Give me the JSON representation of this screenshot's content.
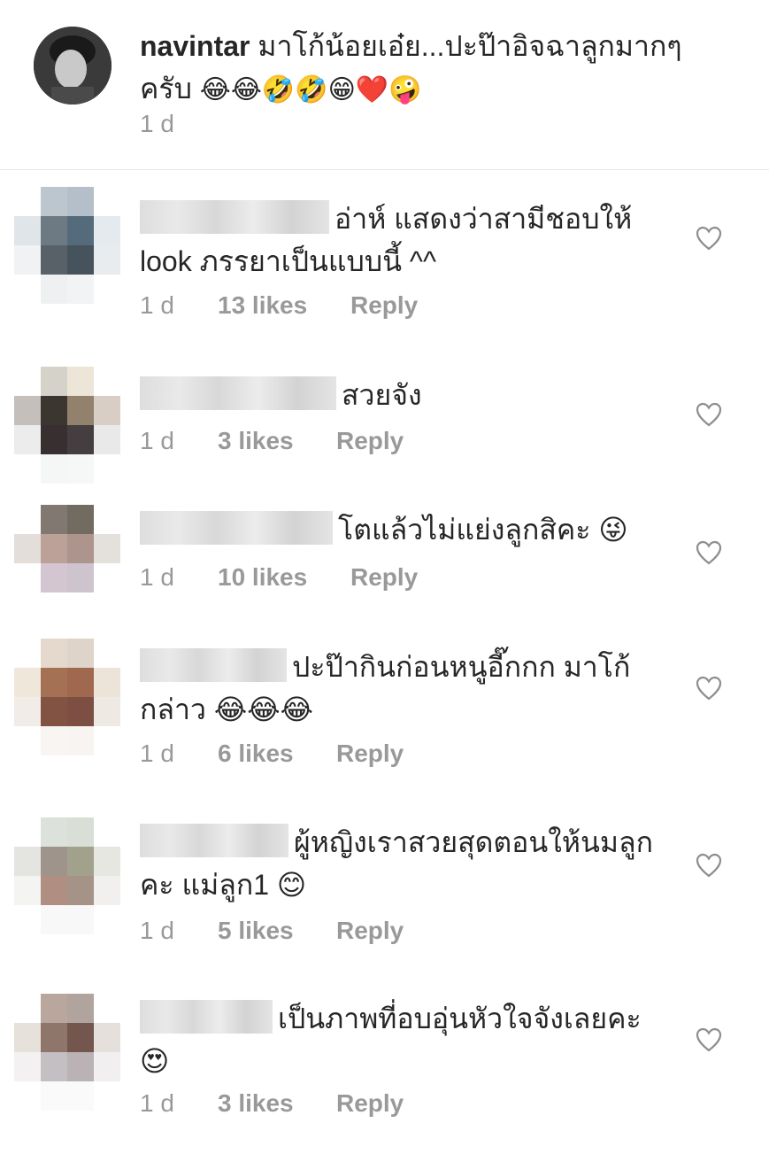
{
  "caption": {
    "username": "navintar",
    "text": "มาโก้น้อยเอ๋ย...ปะป๊าอิจฉาลูกมากๆ ครับ",
    "emojis": [
      "😂",
      "😂",
      "🤣",
      "🤣",
      "😁",
      "❤️",
      "🤪"
    ],
    "time": "1 d"
  },
  "comments": [
    {
      "text": "อ่าห์ แสดงว่าสามีชอบให้ look ภรรยาเป็นแบบนี้ ^^",
      "time": "1 d",
      "likes": "13 likes",
      "reply": "Reply"
    },
    {
      "text": "สวยจัง",
      "time": "1 d",
      "likes": "3 likes",
      "reply": "Reply"
    },
    {
      "text": "โตแล้วไม่แย่งลูกสิคะ",
      "emoji": "😜",
      "time": "1 d",
      "likes": "10 likes",
      "reply": "Reply"
    },
    {
      "text": "ปะป๊ากินก่อนหนูอี๊กกก มาโก้ กล่าว",
      "emoji": "😂😂😂",
      "time": "1 d",
      "likes": "6 likes",
      "reply": "Reply"
    },
    {
      "text": "ผู้หญิงเราสวยสุดตอนให้นมลูก คะ แม่ลูก1",
      "emoji": "😊",
      "time": "1 d",
      "likes": "5 likes",
      "reply": "Reply"
    },
    {
      "text": "เป็นภาพที่อบอุ่นหัวใจจังเลยคะ",
      "emoji": "😍",
      "time": "1 d",
      "likes": "3 likes",
      "reply": "Reply"
    }
  ],
  "icons": {
    "like": "heart-outline-icon"
  },
  "colors": {
    "meta": "#999999",
    "text": "#262626",
    "divider": "#e6e6e6"
  }
}
